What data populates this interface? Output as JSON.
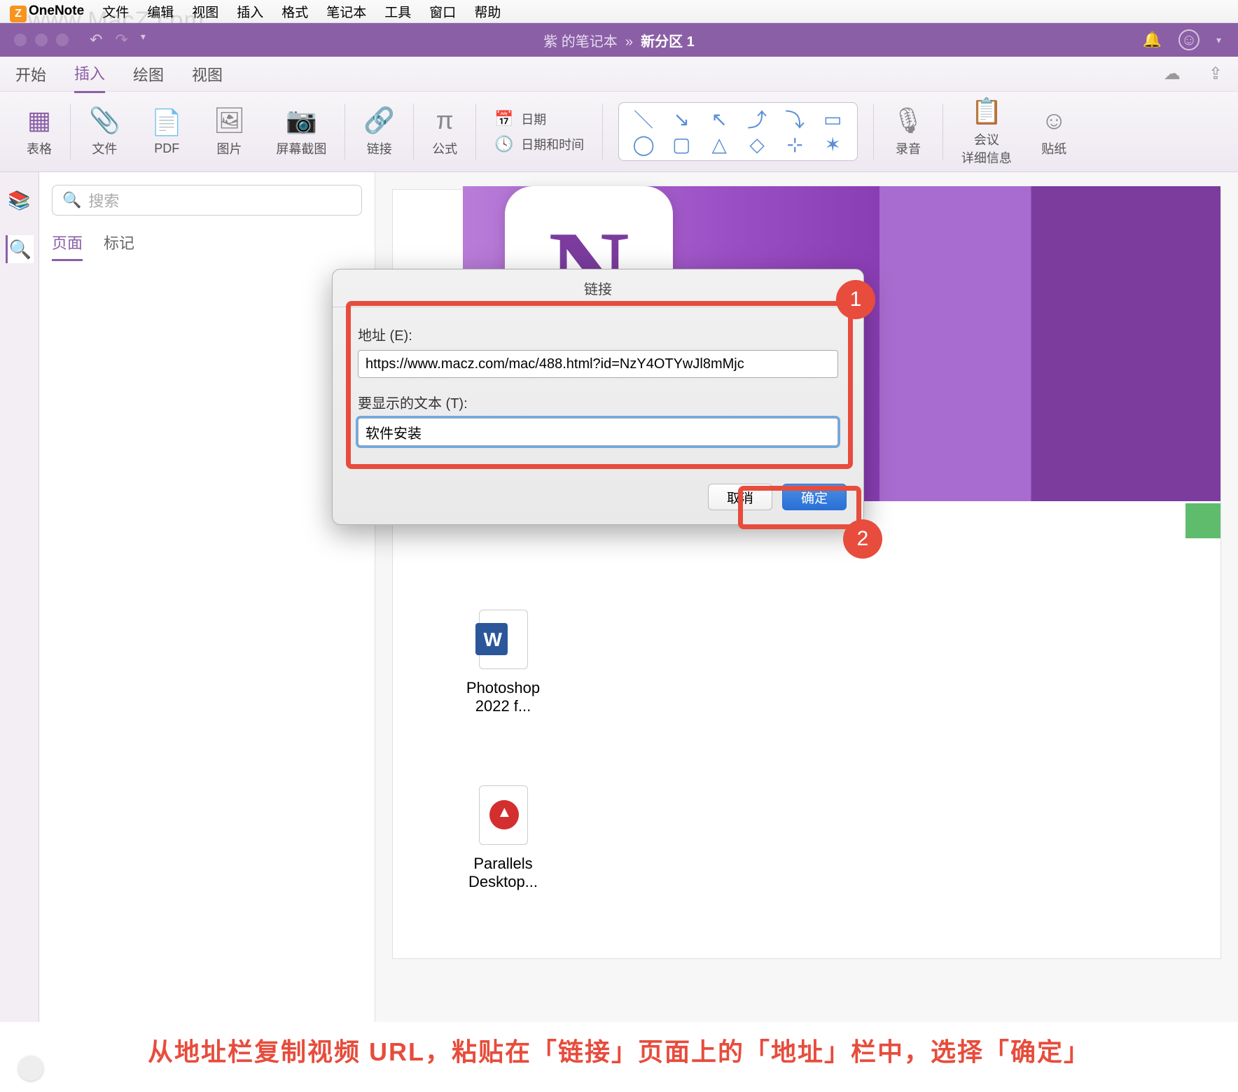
{
  "menubar": {
    "appname": "OneNote",
    "items": [
      "文件",
      "编辑",
      "视图",
      "插入",
      "格式",
      "笔记本",
      "工具",
      "窗口",
      "帮助"
    ]
  },
  "titlebar": {
    "notebook": "紫 的笔记本",
    "sep": "»",
    "section": "新分区 1"
  },
  "ribbon_tabs": {
    "t0": "开始",
    "t1": "插入",
    "t2": "绘图",
    "t3": "视图"
  },
  "ribbon": {
    "table": "表格",
    "file": "文件",
    "pdf": "PDF",
    "image": "图片",
    "screenshot": "屏幕截图",
    "link": "链接",
    "formula": "公式",
    "date": "日期",
    "datetime": "日期和时间",
    "audio": "录音",
    "meeting": "会议\n详细信息",
    "sticker": "贴纸"
  },
  "sidepanel": {
    "search_placeholder": "搜索",
    "tab_pages": "页面",
    "tab_tags": "标记"
  },
  "dialog": {
    "title": "链接",
    "addr_label": "地址 (E):",
    "addr_value": "https://www.macz.com/mac/488.html?id=NzY4OTYwJl8mMjc",
    "text_label": "要显示的文本 (T):",
    "text_value": "软件安装",
    "cancel": "取消",
    "ok": "确定"
  },
  "files": {
    "f1": "Photoshop 2022 f...",
    "f2": "Parallels Desktop..."
  },
  "badges": {
    "b1": "1",
    "b2": "2"
  },
  "caption": "从地址栏复制视频 URL，粘贴在「链接」页面上的「地址」栏中，选择「确定」",
  "watermark": "www.MacZ.com"
}
